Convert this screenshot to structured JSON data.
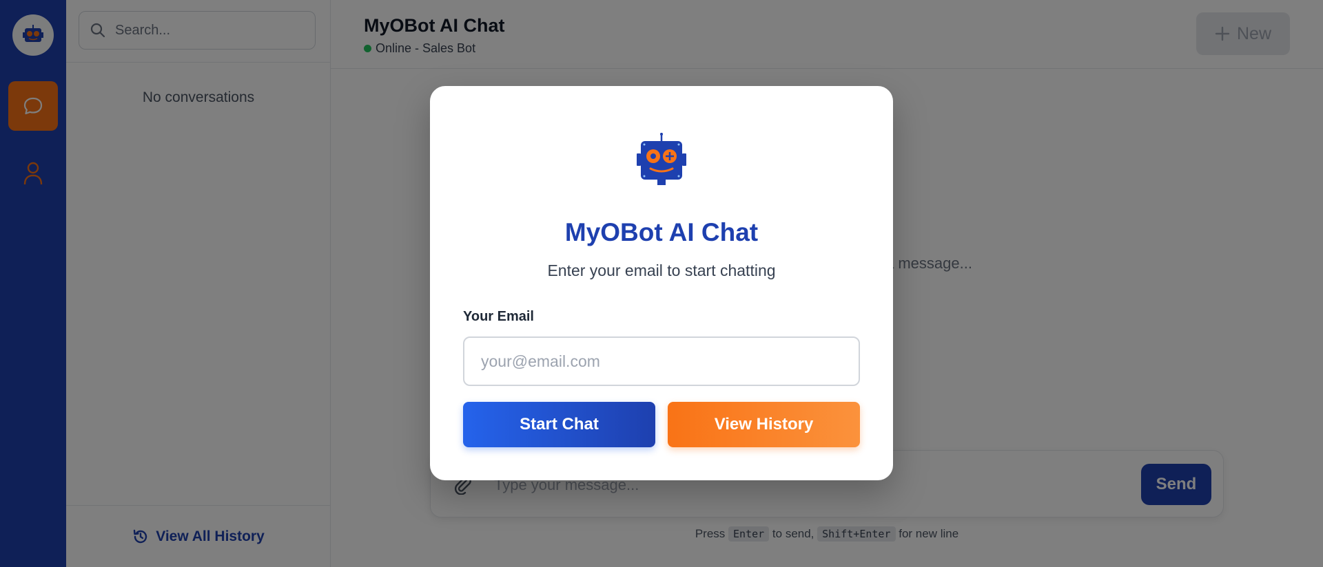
{
  "app": {
    "title": "MyOBot AI Chat",
    "status": "Online - Sales Bot",
    "new_button": "New"
  },
  "sidebar": {
    "search_placeholder": "Search...",
    "empty_text": "No conversations",
    "view_all_history": "View All History"
  },
  "main": {
    "empty_hint": "Start a conversation by typing a message...",
    "composer_placeholder": "Type your message...",
    "send_label": "Send",
    "hint_press": "Press",
    "hint_enter_key": "Enter",
    "hint_to_send": "to send,",
    "hint_shift_key": "Shift+Enter",
    "hint_new_line": "for new line"
  },
  "modal": {
    "title": "MyOBot AI Chat",
    "subtitle": "Enter your email to start chatting",
    "email_label": "Your Email",
    "email_placeholder": "your@email.com",
    "email_value": "",
    "start_button": "Start Chat",
    "history_button": "View History"
  },
  "icons": {
    "logo": "robot-icon",
    "chat": "chat-bubble-icon",
    "user": "user-icon",
    "search": "search-icon",
    "history": "history-icon",
    "plus": "plus-icon",
    "attach": "paperclip-icon"
  },
  "colors": {
    "brand_blue": "#1e40af",
    "accent_orange": "#f97316",
    "status_green": "#22c55e"
  }
}
